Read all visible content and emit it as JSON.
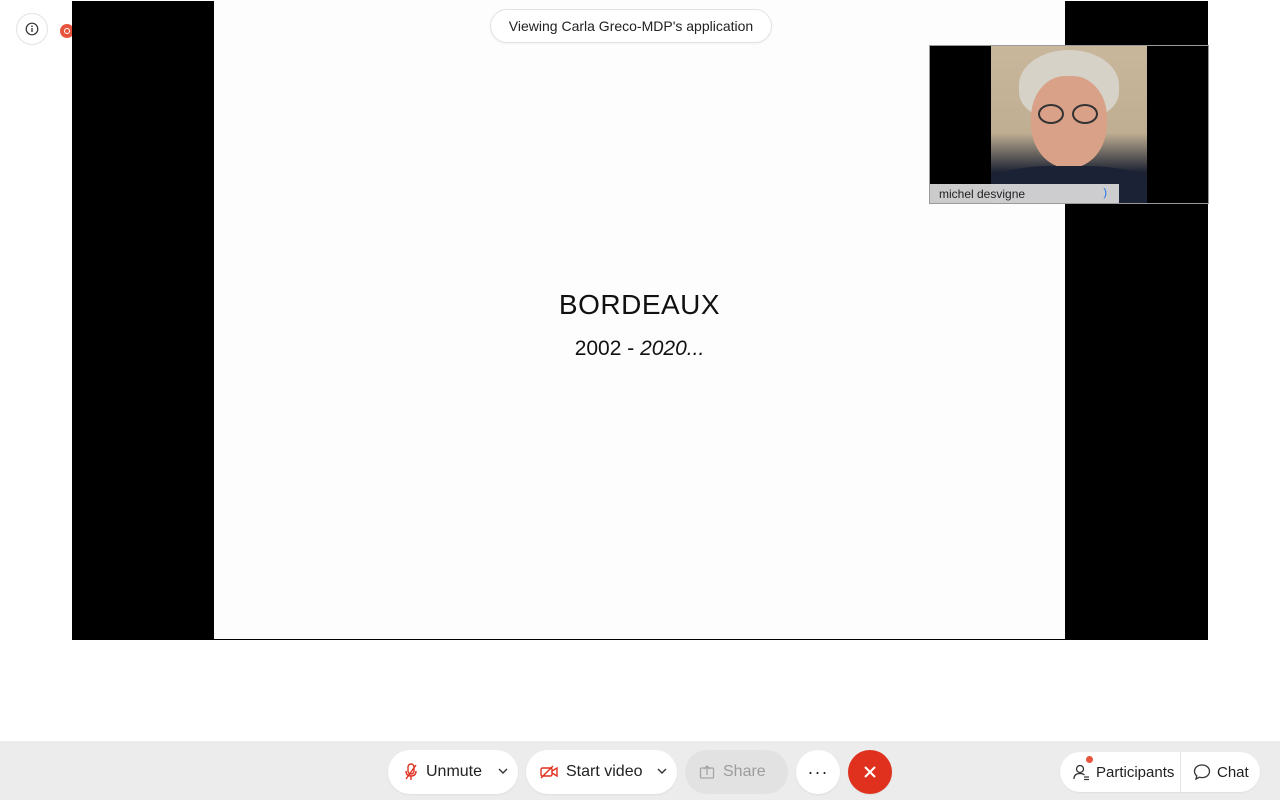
{
  "window": {
    "indicator": "recording"
  },
  "banner": {
    "viewing_text": "Viewing Carla Greco-MDP's application"
  },
  "slide": {
    "title": "BORDEAUX",
    "subtitle_years": "2002 - ",
    "subtitle_italic": "2020..."
  },
  "video_tile": {
    "participant_name": "michel desvigne",
    "audio_icon": "audio-level-icon"
  },
  "controls": {
    "unmute_label": "Unmute",
    "start_video_label": "Start video",
    "share_label": "Share",
    "more_label": "···",
    "participants_label": "Participants",
    "chat_label": "Chat"
  },
  "colors": {
    "accent_red": "#e0301e",
    "record_red": "#e8553e",
    "bar_bg": "#ececec"
  }
}
